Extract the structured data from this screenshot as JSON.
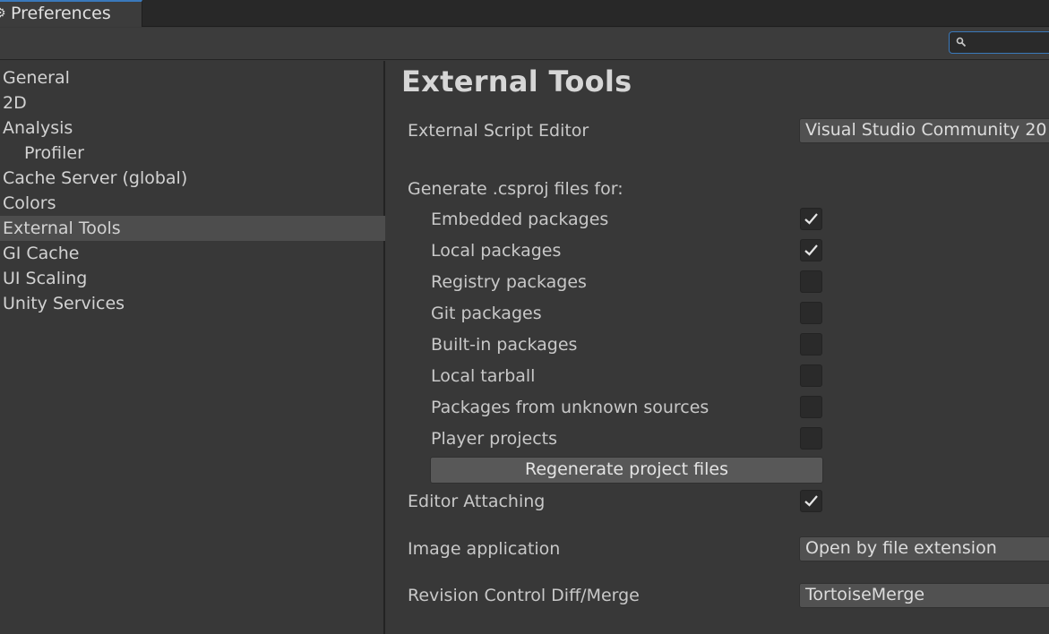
{
  "window": {
    "tab_title": "Preferences"
  },
  "search": {
    "value": "",
    "icon": "search-icon"
  },
  "sidebar": {
    "items": [
      {
        "label": "General"
      },
      {
        "label": "2D"
      },
      {
        "label": "Analysis"
      },
      {
        "label": "Profiler"
      },
      {
        "label": "Cache Server (global)"
      },
      {
        "label": "Colors"
      },
      {
        "label": "External Tools",
        "selected": true
      },
      {
        "label": "GI Cache"
      },
      {
        "label": "UI Scaling"
      },
      {
        "label": "Unity Services"
      }
    ]
  },
  "main": {
    "title": "External Tools",
    "script_editor": {
      "label": "External Script Editor",
      "value": "Visual Studio Community 20"
    },
    "generate_label": "Generate .csproj files for:",
    "packages": [
      {
        "label": "Embedded packages",
        "checked": true
      },
      {
        "label": "Local packages",
        "checked": true
      },
      {
        "label": "Registry packages",
        "checked": false
      },
      {
        "label": "Git packages",
        "checked": false
      },
      {
        "label": "Built-in packages",
        "checked": false
      },
      {
        "label": "Local tarball",
        "checked": false
      },
      {
        "label": "Packages from unknown sources",
        "checked": false
      },
      {
        "label": "Player projects",
        "checked": false
      }
    ],
    "regenerate_button": "Regenerate project files",
    "editor_attaching": {
      "label": "Editor Attaching",
      "checked": true
    },
    "image_application": {
      "label": "Image application",
      "value": "Open by file extension"
    },
    "revision_control": {
      "label": "Revision Control Diff/Merge",
      "value": "TortoiseMerge"
    }
  },
  "colors": {
    "accent": "#3a79bb",
    "selected_row": "#4d4d4d",
    "background": "#383838"
  }
}
